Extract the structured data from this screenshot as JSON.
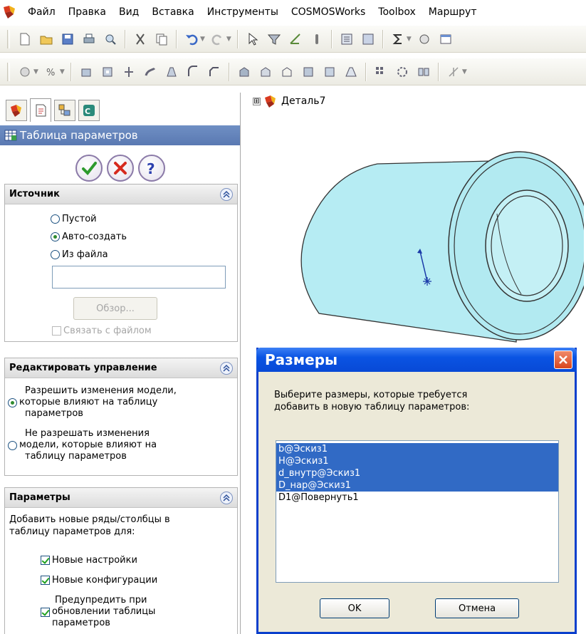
{
  "menubar": {
    "items": [
      "Файл",
      "Правка",
      "Вид",
      "Вставка",
      "Инструменты",
      "COSMOSWorks",
      "Toolbox",
      "Маршрут"
    ]
  },
  "property_manager": {
    "title": "Таблица параметров",
    "source": {
      "header": "Источник",
      "options": [
        "Пустой",
        "Авто-создать",
        "Из файла"
      ],
      "selected": "Авто-создать",
      "file_value": "",
      "browse_label": "Обзор...",
      "link_label": "Связать с файлом"
    },
    "edit_control": {
      "header": "Редактировать управление",
      "option1": [
        "Разрешить изменения модели,",
        "которые влияют на таблицу",
        "параметров"
      ],
      "option2": [
        "Не разрешать изменения",
        "модели, которые влияют на",
        "таблицу параметров"
      ]
    },
    "params": {
      "header": "Параметры",
      "intro": [
        "Добавить новые ряды/столбцы в",
        "таблицу параметров для:"
      ],
      "check1": "Новые настройки",
      "check2": "Новые конфигурации",
      "check3": [
        "Предупредить при",
        "обновлении таблицы",
        "параметров"
      ]
    }
  },
  "tree": {
    "root": "Деталь7",
    "toggle": "⊞"
  },
  "dialog": {
    "title": "Размеры",
    "message": [
      "Выберите размеры, которые требуется",
      "добавить в новую таблицу параметров:"
    ],
    "items": [
      {
        "label": "b@Эскиз1",
        "selected": true
      },
      {
        "label": "H@Эскиз1",
        "selected": true
      },
      {
        "label": "d_внутр@Эскиз1",
        "selected": true
      },
      {
        "label": "D_нар@Эскиз1",
        "selected": true
      },
      {
        "label": "D1@Повернуть1",
        "selected": false
      }
    ],
    "ok": "OK",
    "cancel": "Отмена"
  },
  "colors": {
    "title_blue": "#0a54e3",
    "selection": "#316ac5",
    "panel_title": "#6f8fc4",
    "part_fill": "#b6ecf3"
  }
}
